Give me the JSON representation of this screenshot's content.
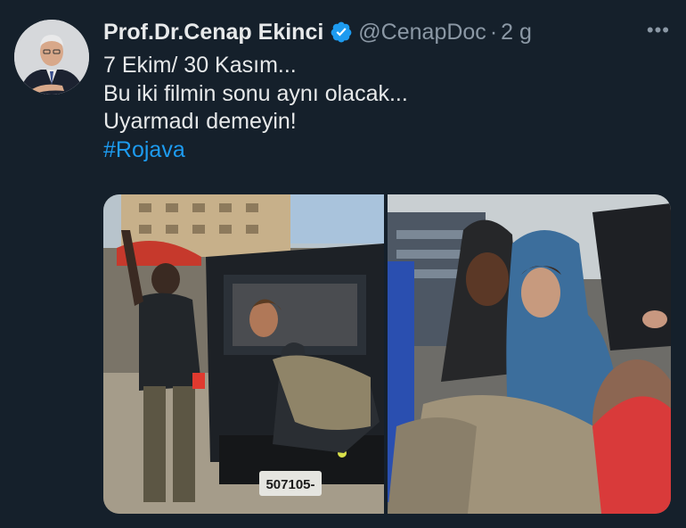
{
  "tweet": {
    "author_name": "Prof.Dr.Cenap Ekinci",
    "handle": "@CenapDoc",
    "separator": "·",
    "time": "2 g",
    "more_icon": "more-dots-icon",
    "verified_icon": "verified-badge-icon",
    "text_lines": [
      "7 Ekim/ 30 Kasım...",
      "Bu iki filmin  sonu  aynı olacak...",
      "Uyarmadı demeyin!"
    ],
    "hashtag": "#Rojava",
    "media": {
      "left_plate": "507105-"
    }
  },
  "colors": {
    "background": "#15202b",
    "text": "#e7e9ea",
    "muted": "#8b98a5",
    "accent": "#1d9bf0"
  }
}
